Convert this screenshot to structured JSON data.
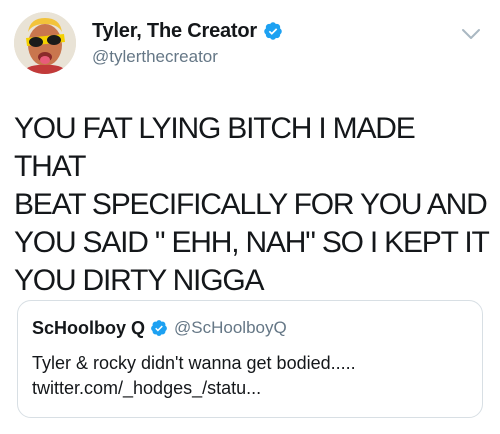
{
  "tweet": {
    "author": {
      "display_name": "Tyler, The Creator",
      "handle": "@tylerthecreator",
      "verified": true
    },
    "text": "YOU FAT LYING BITCH I MADE THAT\nBEAT SPECIFICALLY FOR YOU AND\nYOU SAID \" EHH, NAH\" SO I KEPT IT\nYOU DIRTY NIGGA"
  },
  "quoted_tweet": {
    "author": {
      "display_name": "ScHoolboy Q",
      "handle": "@ScHoolboyQ",
      "verified": true
    },
    "line1": "Tyler & rocky didn't wanna get bodied.....",
    "line2": "twitter.com/_hodges_/statu..."
  },
  "colors": {
    "verified_blue": "#1da1f2",
    "secondary_text": "#657786",
    "border": "#d8dfe4"
  },
  "icons": {
    "verified": "verified-badge-icon",
    "menu": "chevron-down-icon"
  }
}
